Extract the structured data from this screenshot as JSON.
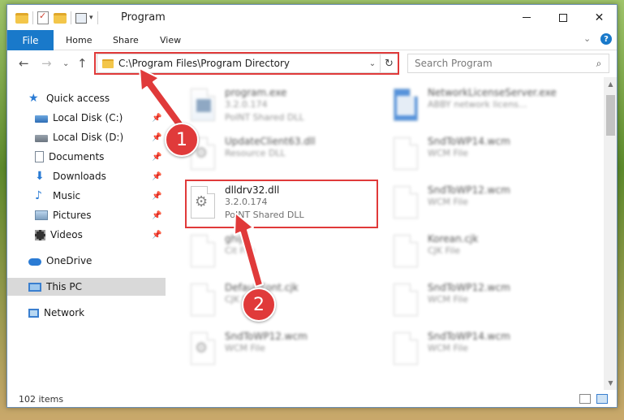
{
  "window": {
    "title": "Program"
  },
  "ribbon": {
    "file": "File",
    "tabs": [
      "Home",
      "Share",
      "View"
    ]
  },
  "address": {
    "path": "C:\\Program Files\\Program Directory",
    "search_placeholder": "Search Program"
  },
  "nav": {
    "items": [
      {
        "label": "Quick access",
        "icon": "star-icon"
      },
      {
        "label": "Local Disk (C:)",
        "icon": "drive-icon",
        "pinned": true
      },
      {
        "label": "Local Disk (D:)",
        "icon": "drive-icon",
        "pinned": true
      },
      {
        "label": "Documents",
        "icon": "documents-icon",
        "pinned": true
      },
      {
        "label": "Downloads",
        "icon": "download-icon",
        "pinned": true
      },
      {
        "label": "Music",
        "icon": "music-icon",
        "pinned": true
      },
      {
        "label": "Pictures",
        "icon": "pictures-icon",
        "pinned": true
      },
      {
        "label": "Videos",
        "icon": "videos-icon",
        "pinned": true
      },
      {
        "label": "OneDrive",
        "icon": "cloud-icon"
      },
      {
        "label": "This PC",
        "icon": "computer-icon",
        "selected": true
      },
      {
        "label": "Network",
        "icon": "network-icon"
      }
    ]
  },
  "files": {
    "left": [
      {
        "name": "program.exe",
        "line1": "3.2.0.174",
        "line2": "PoINT Shared DLL",
        "icon": "exe"
      },
      {
        "name": "UpdateClient63.dll",
        "line1": "Resource DLL",
        "line2": "",
        "icon": "gear"
      },
      {
        "name": "dlldrv32.dll",
        "line1": "3.2.0.174",
        "line2": "PoINT Shared DLL",
        "icon": "gear",
        "highlighted": true
      },
      {
        "name": "ghijk",
        "line1": "Cit File",
        "line2": "",
        "icon": "blank"
      },
      {
        "name": "DefaultFont.cjk",
        "line1": "CJK File",
        "line2": "",
        "icon": "blank"
      },
      {
        "name": "SndToWP12.wcm",
        "line1": "WCM File",
        "line2": "",
        "icon": "gear"
      }
    ],
    "right": [
      {
        "name": "NetworkLicenseServer.exe",
        "line1": "ABBY network licens...",
        "line2": "",
        "icon": "app"
      },
      {
        "name": "SndToWP14.wcm",
        "line1": "WCM File",
        "line2": "",
        "icon": "blank"
      },
      {
        "name": "SndToWP12.wcm",
        "line1": "WCM File",
        "line2": "",
        "icon": "blank"
      },
      {
        "name": "Korean.cjk",
        "line1": "CJK File",
        "line2": "",
        "icon": "blank"
      },
      {
        "name": "SndToWP12.wcm",
        "line1": "WCM File",
        "line2": "",
        "icon": "blank"
      },
      {
        "name": "SndToWP14.wcm",
        "line1": "WCM File",
        "line2": "",
        "icon": "blank"
      }
    ]
  },
  "status": {
    "count": "102 items"
  },
  "callouts": [
    "1",
    "2"
  ],
  "colors": {
    "accent": "#1979ca",
    "callout_red": "#e03a3a"
  }
}
